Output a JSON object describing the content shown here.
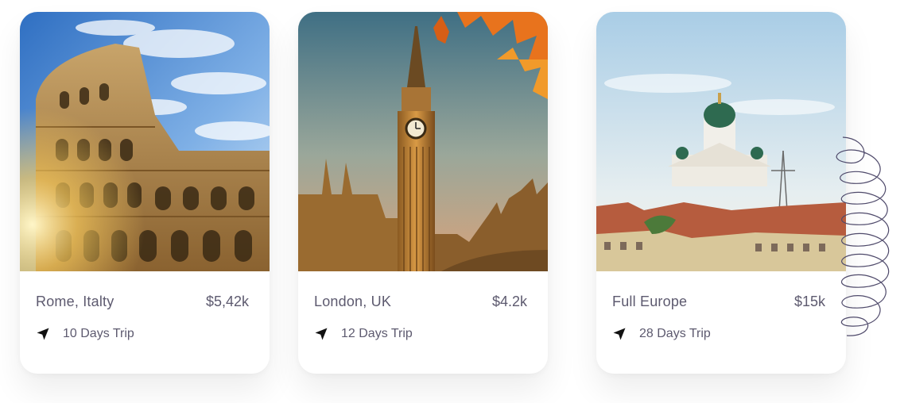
{
  "cards": [
    {
      "title": "Rome, Italty",
      "price": "$5,42k",
      "trip": "10 Days Trip",
      "image_icon": "colosseum-photo"
    },
    {
      "title": "London, UK",
      "price": "$4.2k",
      "trip": "12 Days Trip",
      "image_icon": "big-ben-photo"
    },
    {
      "title": "Full Europe",
      "price": "$15k",
      "trip": "28 Days Trip",
      "image_icon": "helsinki-cathedral-photo"
    }
  ],
  "colors": {
    "text": "#5d5a6f",
    "icon": "#111111",
    "decoration": "#4f4a6b"
  },
  "icons": {
    "trip": "navigation-arrow-icon",
    "decoration": "spiral-loop-decoration"
  }
}
